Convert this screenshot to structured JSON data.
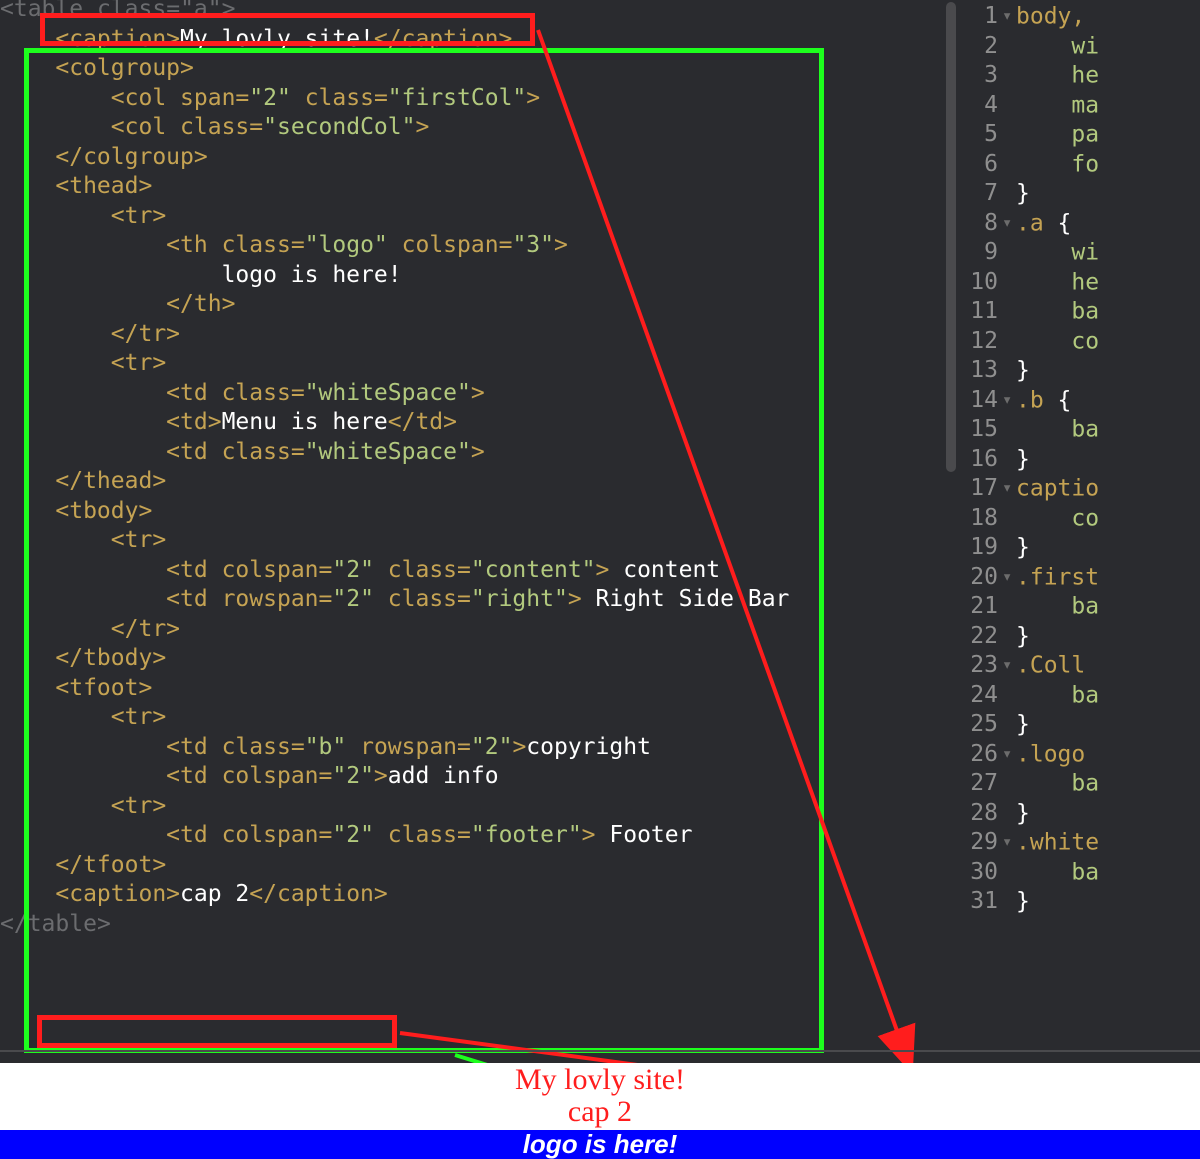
{
  "left_code": {
    "lines": [
      {
        "text": "<table class=\"a\">",
        "kind": "dim"
      },
      {
        "text": "    <caption>",
        "content": "My lovly site!",
        "close": "</caption>"
      },
      {
        "text": "    <colgroup>"
      },
      {
        "text": "        <col span=\"2\" class=\"firstCol\">"
      },
      {
        "text": "        <col class=\"secondCol\">"
      },
      {
        "text": "    </colgroup>"
      },
      {
        "text": "    <thead>"
      },
      {
        "text": "        <tr>"
      },
      {
        "text": "            <th class=\"logo\" colspan=\"3\">"
      },
      {
        "text": "                ",
        "content": "logo is here!"
      },
      {
        "text": "            </th>"
      },
      {
        "text": "        </tr>"
      },
      {
        "text": "        <tr>"
      },
      {
        "text": "            <td class=\"whiteSpace\">"
      },
      {
        "text": "            <td>",
        "content": "Menu is here",
        "close": "</td>"
      },
      {
        "text": "            <td class=\"whiteSpace\">"
      },
      {
        "text": "    </thead>"
      },
      {
        "text": "    <tbody>"
      },
      {
        "text": "        <tr>"
      },
      {
        "text": "            <td colspan=\"2\" class=\"content\">",
        "content": " content"
      },
      {
        "text": "            <td rowspan=\"2\" class=\"right\">",
        "content": " Right Side Bar"
      },
      {
        "text": "        </tr>"
      },
      {
        "text": "    </tbody>"
      },
      {
        "text": "    <tfoot>"
      },
      {
        "text": "        <tr>"
      },
      {
        "text": "            <td class=\"b\" rowspan=\"2\">",
        "content": "copyright"
      },
      {
        "text": "            <td colspan=\"2\">",
        "content": "add info"
      },
      {
        "text": "        <tr>"
      },
      {
        "text": "            <td colspan=\"2\" class=\"footer\">",
        "content": " Footer"
      },
      {
        "text": "    </tfoot>"
      },
      {
        "text": "    <caption>",
        "content": "cap 2",
        "close": "</caption>"
      },
      {
        "text": "</table>",
        "kind": "dim"
      }
    ]
  },
  "right_css": {
    "lines": [
      {
        "n": "1",
        "fold": true,
        "text": "body,"
      },
      {
        "n": "2",
        "text": "    wi"
      },
      {
        "n": "3",
        "text": "    he"
      },
      {
        "n": "4",
        "text": "    ma"
      },
      {
        "n": "5",
        "text": "    pa"
      },
      {
        "n": "6",
        "text": "    fo"
      },
      {
        "n": "7",
        "text": "}"
      },
      {
        "n": "8",
        "fold": true,
        "text": ".a {"
      },
      {
        "n": "9",
        "text": "    wi"
      },
      {
        "n": "10",
        "text": "    he"
      },
      {
        "n": "11",
        "text": "    ba"
      },
      {
        "n": "12",
        "text": "    co"
      },
      {
        "n": "13",
        "text": "}"
      },
      {
        "n": "14",
        "fold": true,
        "text": ".b {"
      },
      {
        "n": "15",
        "text": "    ba"
      },
      {
        "n": "16",
        "text": "}"
      },
      {
        "n": "17",
        "fold": true,
        "text": "captio"
      },
      {
        "n": "18",
        "text": "    co"
      },
      {
        "n": "19",
        "text": "}"
      },
      {
        "n": "20",
        "fold": true,
        "text": ".first"
      },
      {
        "n": "21",
        "text": "    ba"
      },
      {
        "n": "22",
        "text": "}"
      },
      {
        "n": "23",
        "fold": true,
        "text": ".Coll"
      },
      {
        "n": "24",
        "text": "    ba"
      },
      {
        "n": "25",
        "text": "}"
      },
      {
        "n": "26",
        "fold": true,
        "text": ".logo"
      },
      {
        "n": "27",
        "text": "    ba"
      },
      {
        "n": "28",
        "text": "}"
      },
      {
        "n": "29",
        "fold": true,
        "text": ".white"
      },
      {
        "n": "30",
        "text": "    ba"
      },
      {
        "n": "31",
        "text": "}"
      }
    ]
  },
  "preview": {
    "caption1": "My lovly site!",
    "caption2": "cap 2",
    "logo": "logo is here!"
  }
}
